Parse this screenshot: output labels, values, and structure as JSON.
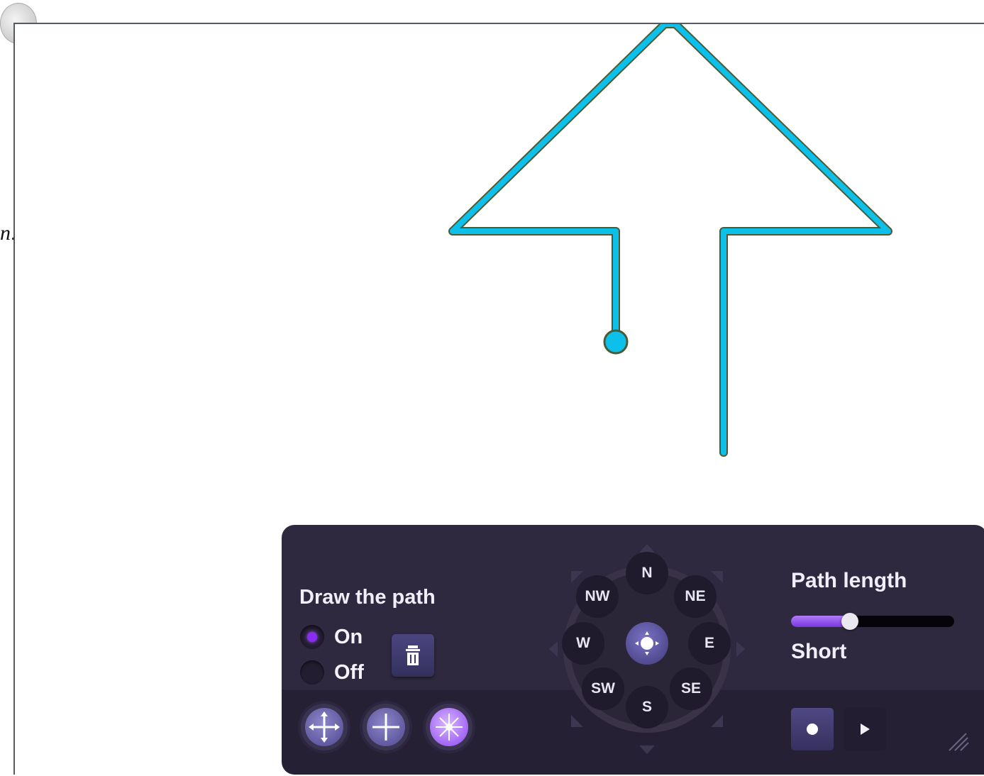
{
  "side_glyph": "n:",
  "path": {
    "color": "#0cc0ea",
    "outline_color": "#4b5a36"
  },
  "controls": {
    "draw_title": "Draw the path",
    "on_label": "On",
    "off_label": "Off",
    "selected": "On",
    "accent": "#8b2cf3",
    "trash_icon": "trash-icon",
    "tools": [
      "move-icon",
      "crosshair-icon",
      "sparkle-icon"
    ]
  },
  "compass": {
    "N": "N",
    "NE": "NE",
    "E": "E",
    "SE": "SE",
    "S": "S",
    "SW": "SW",
    "W": "W",
    "NW": "NW"
  },
  "path_length": {
    "title": "Path length",
    "value_label": "Short",
    "level": 0.36
  },
  "playback": {
    "record_icon": "record-icon",
    "play_icon": "play-icon"
  }
}
